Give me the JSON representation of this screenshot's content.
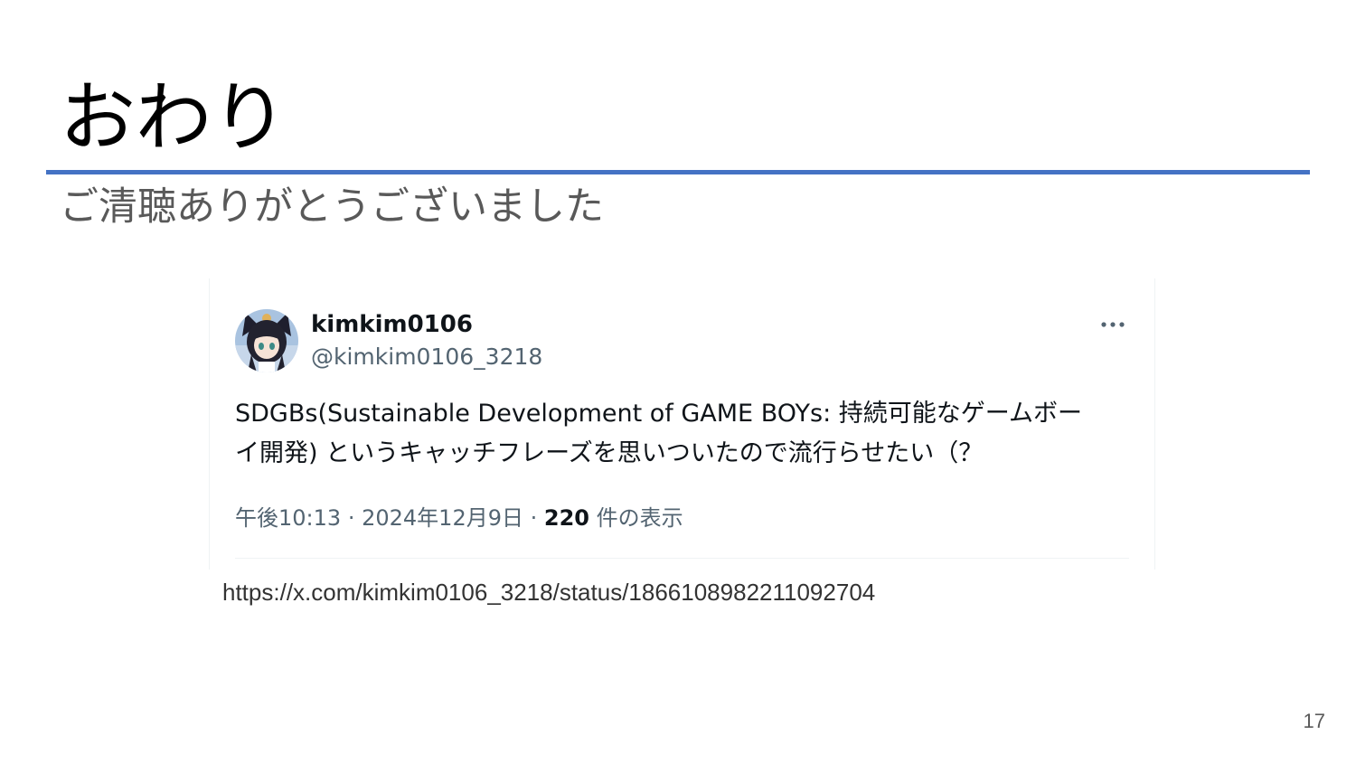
{
  "slide": {
    "title": "おわり",
    "subtitle": "ご清聴ありがとうございました",
    "accent_color": "#4472c4",
    "page_number": "17"
  },
  "tweet": {
    "display_name": "kimkim0106",
    "handle": "@kimkim0106_3218",
    "more_icon": "more-horizontal-icon",
    "text_line_1": "SDGBs(Sustainable Development of GAME BOYs: 持続可能なゲームボー",
    "text_line_2": "イ開発) というキャッチフレーズを思いついたので流行らせたい（？",
    "time": "午後10:13",
    "separator": "·",
    "date": "2024年12月9日",
    "views_count": "220",
    "views_label": "件の表示"
  },
  "source": {
    "url": "https://x.com/kimkim0106_3218/status/1866108982211092704"
  }
}
